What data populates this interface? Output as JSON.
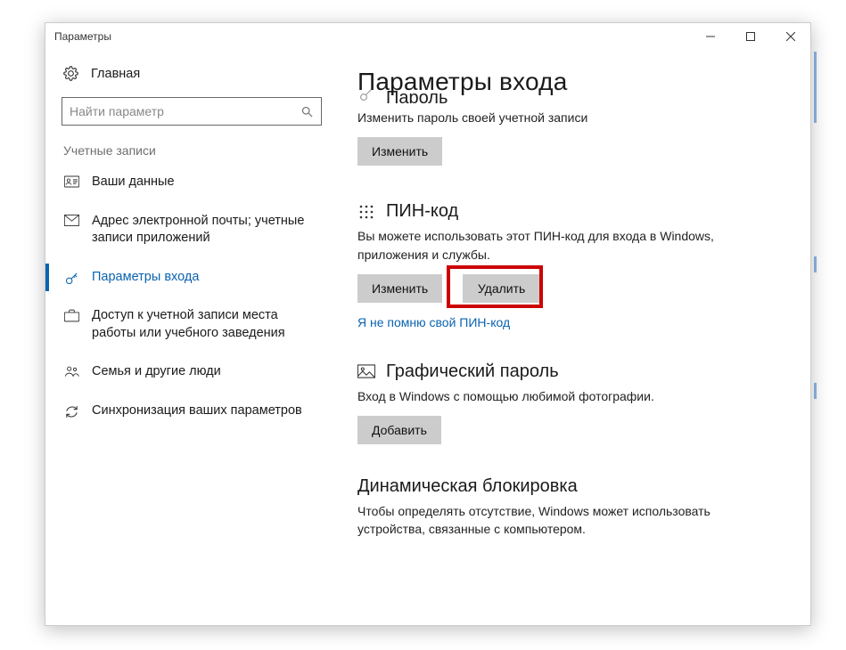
{
  "window": {
    "title": "Параметры"
  },
  "sidebar": {
    "home": "Главная",
    "search_placeholder": "Найти параметр",
    "group_title": "Учетные записи",
    "items": [
      {
        "label": "Ваши данные"
      },
      {
        "label": "Адрес электронной почты; учетные записи приложений"
      },
      {
        "label": "Параметры входа"
      },
      {
        "label": "Доступ к учетной записи места работы или учебного заведения"
      },
      {
        "label": "Семья и другие люди"
      },
      {
        "label": "Синхронизация ваших параметров"
      }
    ]
  },
  "main": {
    "page_title": "Параметры входа",
    "password": {
      "title": "Пароль",
      "desc": "Изменить пароль своей учетной записи",
      "change": "Изменить"
    },
    "pin": {
      "title": "ПИН-код",
      "desc": "Вы можете использовать этот ПИН-код для входа в Windows, приложения и службы.",
      "change": "Изменить",
      "remove": "Удалить",
      "forgot": "Я не помню свой ПИН-код"
    },
    "picture": {
      "title": "Графический пароль",
      "desc": "Вход в Windows с помощью любимой фотографии.",
      "add": "Добавить"
    },
    "dynamic": {
      "title": "Динамическая блокировка",
      "desc": "Чтобы определять отсутствие, Windows может использовать устройства, связанные с компьютером."
    }
  }
}
